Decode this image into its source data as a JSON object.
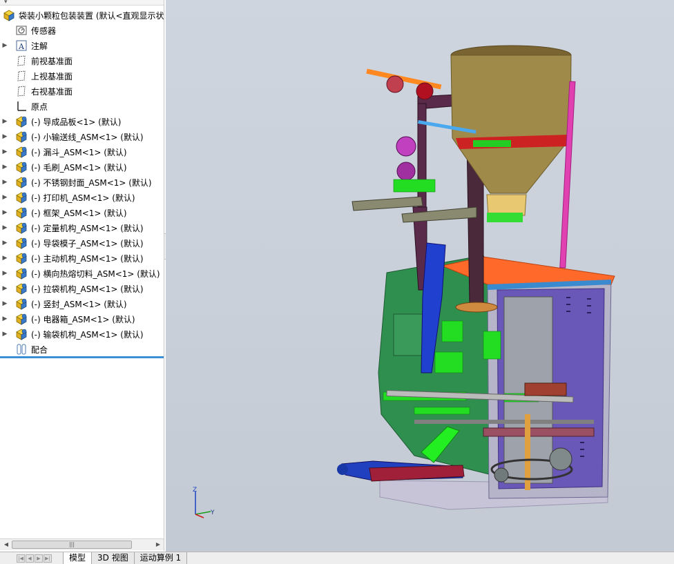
{
  "tree": {
    "root_label": "袋装小颗粒包装装置 (默认<直观显示状",
    "items": [
      {
        "label": "传感器",
        "icon": "sensor-icon",
        "expandable": false
      },
      {
        "label": "注解",
        "icon": "annotation-icon",
        "expandable": true
      },
      {
        "label": "前视基准面",
        "icon": "plane-icon",
        "expandable": false
      },
      {
        "label": "上视基准面",
        "icon": "plane-icon",
        "expandable": false
      },
      {
        "label": "右视基准面",
        "icon": "plane-icon",
        "expandable": false
      },
      {
        "label": "原点",
        "icon": "origin-icon",
        "expandable": false
      },
      {
        "label": "(-) 导成品板<1> (默认)",
        "icon": "subassembly-icon",
        "expandable": true
      },
      {
        "label": "(-) 小输送线_ASM<1> (默认)",
        "icon": "subassembly-icon",
        "expandable": true
      },
      {
        "label": "(-) 漏斗_ASM<1> (默认)",
        "icon": "subassembly-icon",
        "expandable": true
      },
      {
        "label": "(-) 毛刷_ASM<1> (默认)",
        "icon": "subassembly-icon",
        "expandable": true
      },
      {
        "label": "(-) 不锈钢封面_ASM<1> (默认)",
        "icon": "subassembly-icon",
        "expandable": true
      },
      {
        "label": "(-) 打印机_ASM<1> (默认)",
        "icon": "subassembly-icon",
        "expandable": true
      },
      {
        "label": "(-) 框架_ASM<1> (默认)",
        "icon": "subassembly-icon",
        "expandable": true
      },
      {
        "label": "(-) 定量机构_ASM<1> (默认)",
        "icon": "subassembly-icon",
        "expandable": true
      },
      {
        "label": "(-) 导袋模子_ASM<1> (默认)",
        "icon": "subassembly-icon",
        "expandable": true
      },
      {
        "label": "(-) 主动机构_ASM<1> (默认)",
        "icon": "subassembly-icon",
        "expandable": true
      },
      {
        "label": "(-) 横向热熔切料_ASM<1> (默认)",
        "icon": "subassembly-icon",
        "expandable": true
      },
      {
        "label": "(-) 拉袋机构_ASM<1> (默认)",
        "icon": "subassembly-icon",
        "expandable": true
      },
      {
        "label": "(-) 竖封_ASM<1> (默认)",
        "icon": "subassembly-icon",
        "expandable": true
      },
      {
        "label": "(-) 电器箱_ASM<1> (默认)",
        "icon": "subassembly-icon",
        "expandable": true
      },
      {
        "label": "(-) 输袋机构_ASM<1> (默认)",
        "icon": "subassembly-icon",
        "expandable": true
      },
      {
        "label": "配合",
        "icon": "mates-icon",
        "expandable": false
      }
    ]
  },
  "scrollbar": {
    "thumb_glyph": "|||"
  },
  "triad": {
    "z": "Z",
    "y": "Y"
  },
  "tabs": [
    {
      "label": "模型",
      "active": true
    },
    {
      "label": "3D 视图",
      "active": false
    },
    {
      "label": "运动算例 1",
      "active": false
    }
  ],
  "colors": {
    "viewport_bg": "#c9cfd9",
    "hopper": "#a08a4a",
    "frame_purple": "#5a2a4a",
    "accent_green": "#22dd22",
    "panel_blue": "#5040a0",
    "top_plate": "#ff6a2a",
    "selection_line": "#3a8fd6"
  }
}
